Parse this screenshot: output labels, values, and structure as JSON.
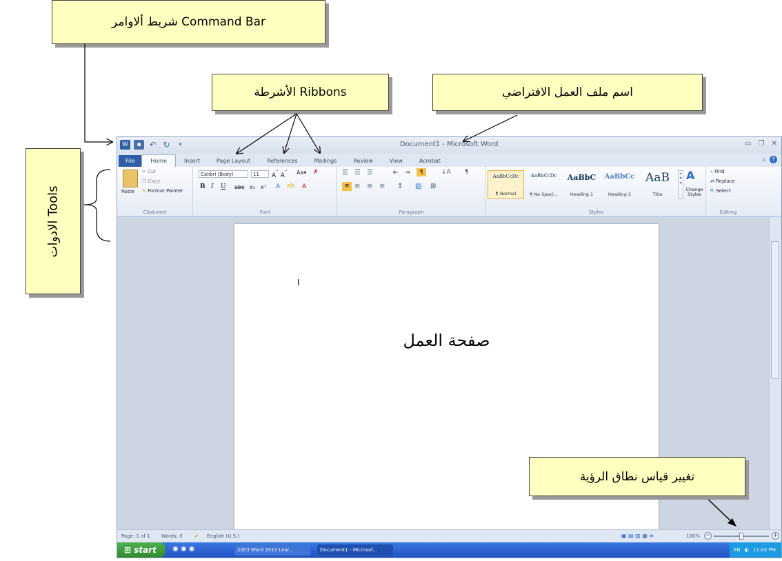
{
  "annotations": {
    "command_bar": "شريط ألاوامر Command Bar",
    "ribbons": "الأشرطة Ribbons",
    "file_name": "اسم ملف العمل الافتراضي",
    "tools": "الادوات Tools",
    "zoom": "تغيير قياس نطاق الرؤية"
  },
  "window": {
    "title": "Document1 - Microsoft Word",
    "tabs": [
      "File",
      "Home",
      "Insert",
      "Page Layout",
      "References",
      "Mailings",
      "Review",
      "View",
      "Acrobat"
    ]
  },
  "ribbon": {
    "clipboard": {
      "label": "Clipboard",
      "paste": "Paste",
      "cut": "Cut",
      "copy": "Copy",
      "format_painter": "Format Painter"
    },
    "font": {
      "label": "Font",
      "font_name": "Calibri (Body)",
      "font_size": "11"
    },
    "paragraph": {
      "label": "Paragraph"
    },
    "styles": {
      "label": "Styles",
      "items": [
        {
          "preview": "AaBbCcDc",
          "name": "¶ Normal"
        },
        {
          "preview": "AaBbCcDc",
          "name": "¶ No Spaci..."
        },
        {
          "preview": "AaBbC",
          "name": "Heading 1"
        },
        {
          "preview": "AaBbCc",
          "name": "Heading 2"
        },
        {
          "preview": "AaB",
          "name": "Title"
        }
      ],
      "change_styles": "Change Styles"
    },
    "editing": {
      "label": "Editing",
      "find": "Find",
      "replace": "Replace",
      "select": "Select"
    }
  },
  "document": {
    "cursor": "I",
    "page_label": "صفحة العمل"
  },
  "status": {
    "page": "Page: 1 of 1",
    "words": "Words: 0",
    "language": "English (U.S.)",
    "zoom": "100%",
    "zoom_level": 0.5
  },
  "taskbar": {
    "start": "start",
    "tasks": [
      "2003 Word 2010 Lear...",
      "Document1 - Microsof..."
    ],
    "lang": "EN",
    "time": "11:42 PM"
  },
  "colors": {
    "accent": "#2d5fa6",
    "callout_fill": "#ffffc0"
  }
}
